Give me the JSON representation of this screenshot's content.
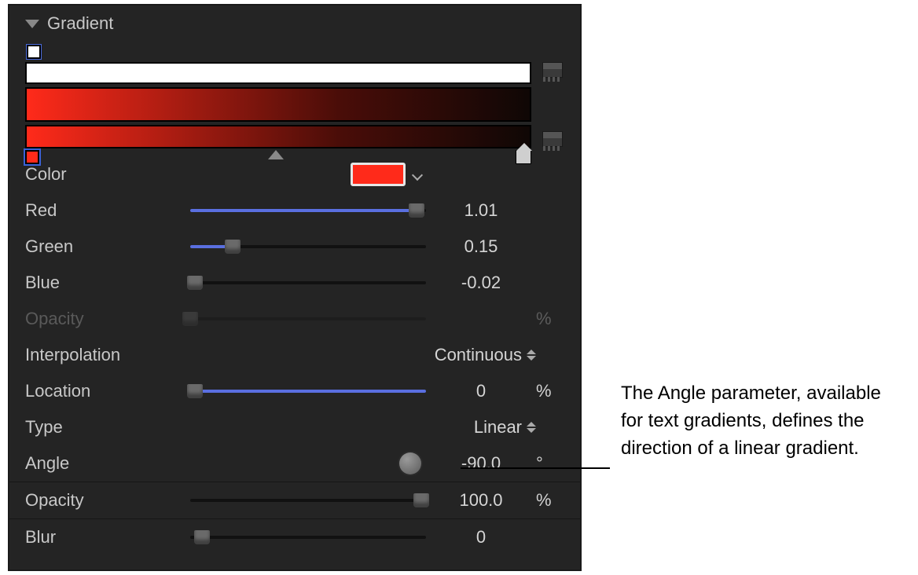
{
  "header": {
    "title": "Gradient"
  },
  "gradient_editor": {
    "start_color": "#ff2a1a",
    "end_color": "#0f0705",
    "selected_stop": "start",
    "opacity_stop_color": "#ffffff"
  },
  "params": {
    "color": {
      "label": "Color",
      "swatch": "#ff2a1a"
    },
    "red": {
      "label": "Red",
      "value": "1.01",
      "pct": 96
    },
    "green": {
      "label": "Green",
      "value": "0.15",
      "pct": 18
    },
    "blue": {
      "label": "Blue",
      "value": "-0.02",
      "pct": 2
    },
    "opacity_stop": {
      "label": "Opacity",
      "value": "",
      "unit": "%",
      "pct": 0
    },
    "interpolation": {
      "label": "Interpolation",
      "value": "Continuous"
    },
    "location": {
      "label": "Location",
      "value": "0",
      "unit": "%",
      "pct": 2
    },
    "type": {
      "label": "Type",
      "value": "Linear"
    },
    "angle": {
      "label": "Angle",
      "value": "-90.0",
      "unit": "°"
    },
    "opacity": {
      "label": "Opacity",
      "value": "100.0",
      "unit": "%",
      "pct": 98
    },
    "blur": {
      "label": "Blur",
      "value": "0",
      "pct": 5
    }
  },
  "callout": "The Angle parameter, available for text gradients, defines the direction of a linear gradient."
}
